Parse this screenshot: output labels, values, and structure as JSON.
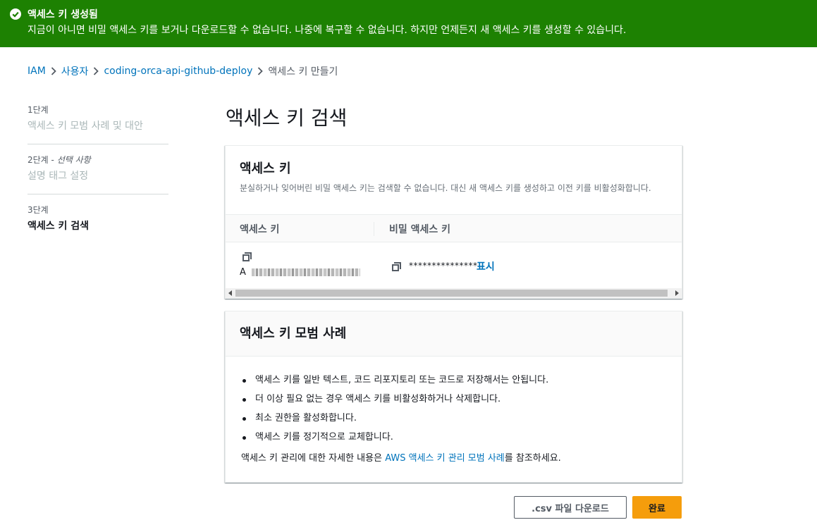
{
  "flash": {
    "title": "액세스 키 생성됨",
    "message": "지금이 아니면 비밀 액세스 키를 보거나 다운로드할 수 없습니다. 나중에 복구할 수 없습니다. 하지만 언제든지 새 액세스 키를 생성할 수 있습니다.",
    "color": "#1d8102"
  },
  "breadcrumb": {
    "items": [
      "IAM",
      "사용자",
      "coding-orca-api-github-deploy"
    ],
    "current": "액세스 키 만들기"
  },
  "steps": [
    {
      "num": "1단계",
      "label": "액세스 키 모범 사례 및 대안"
    },
    {
      "num": "2단계 - ",
      "optional": "선택 사항",
      "label": "설명 태그 설정"
    },
    {
      "num": "3단계",
      "label": "액세스 키 검색"
    }
  ],
  "page_title": "액세스 키 검색",
  "access_key_panel": {
    "title": "액세스 키",
    "description": "분실하거나 잊어버린 비밀 액세스 키는 검색할 수 없습니다. 대신 새 액세스 키를 생성하고 이전 키를 비활성화합니다.",
    "columns": [
      "액세스 키",
      "비밀 액세스 키"
    ],
    "access_key_prefix": "A",
    "secret_masked": "***************",
    "show_label": "표시"
  },
  "best_practices": {
    "title": "액세스 키 모범 사례",
    "items": [
      "액세스 키를 일반 텍스트, 코드 리포지토리 또는 코드로 저장해서는 안됩니다.",
      "더 이상 필요 없는 경우 액세스 키를 비활성화하거나 삭제합니다.",
      "최소 권한을 활성화합니다.",
      "액세스 키를 정기적으로 교체합니다."
    ],
    "more_prefix": "액세스 키 관리에 대한 자세한 내용은 ",
    "more_link": "AWS 액세스 키 관리 모범 사례",
    "more_suffix": "를 참조하세요."
  },
  "buttons": {
    "download_csv": ".csv 파일 다운로드",
    "done": "완료"
  }
}
